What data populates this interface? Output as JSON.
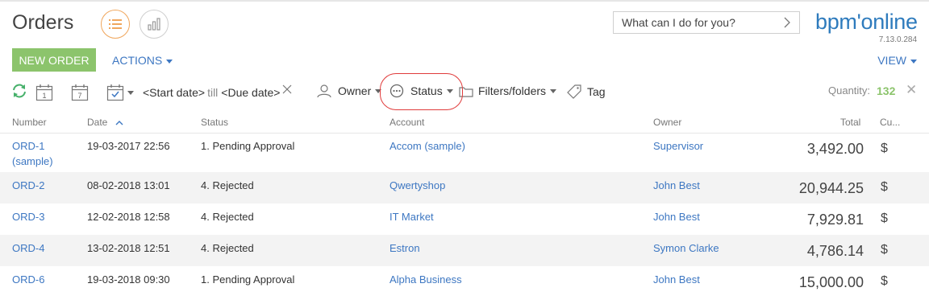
{
  "header": {
    "title": "Orders",
    "search_placeholder": "What can I do for you?",
    "logo": "bpm'online",
    "version": "7.13.0.284"
  },
  "toolbar": {
    "new_order_label": "NEW ORDER",
    "actions_label": "ACTIONS",
    "view_label": "VIEW"
  },
  "filters": {
    "day_icon_text": "1",
    "week_icon_text": "7",
    "start_date": "<Start date>",
    "till": "till",
    "due_date": "<Due date>",
    "owner_label": "Owner",
    "status_label": "Status",
    "folders_label": "Filters/folders",
    "tag_label": "Tag",
    "quantity_label": "Quantity:",
    "quantity_value": "132",
    "highlight_color": "#e03b3b"
  },
  "table": {
    "columns": [
      "Number",
      "Date",
      "Status",
      "Account",
      "Owner",
      "Total",
      "Cu..."
    ],
    "rows": [
      {
        "number": "ORD-1",
        "number2": "(sample)",
        "date": "19-03-2017 22:56",
        "status": "1. Pending Approval",
        "account": "Accom (sample)",
        "owner": "Supervisor",
        "total": "3,492.00",
        "currency": "$"
      },
      {
        "number": "ORD-2",
        "date": "08-02-2018 13:01",
        "status": "4. Rejected",
        "account": "Qwertyshop",
        "owner": "John Best",
        "total": "20,944.25",
        "currency": "$"
      },
      {
        "number": "ORD-3",
        "date": "12-02-2018 12:58",
        "status": "4. Rejected",
        "account": "IT Market",
        "owner": "John Best",
        "total": "7,929.81",
        "currency": "$"
      },
      {
        "number": "ORD-4",
        "date": "13-02-2018 12:51",
        "status": "4. Rejected",
        "account": "Estron",
        "owner": "Symon Clarke",
        "total": "4,786.14",
        "currency": "$"
      },
      {
        "number": "ORD-6",
        "date": "19-03-2018 09:30",
        "status": "1. Pending Approval",
        "account": "Alpha Business",
        "owner": "John Best",
        "total": "15,000.00",
        "currency": "$"
      }
    ]
  },
  "colors": {
    "accent_blue": "#3d77c2",
    "green": "#8cc46c",
    "orange": "#f0a65c"
  }
}
